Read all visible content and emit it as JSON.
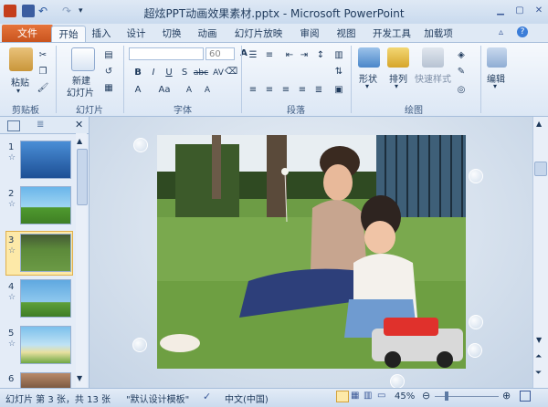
{
  "window": {
    "title": "超炫PPT动画效果素材.pptx - Microsoft PowerPoint",
    "app_icon": "powerpoint-icon",
    "controls": [
      "minimize-icon",
      "maximize-icon",
      "close-icon"
    ]
  },
  "quick_access": [
    "save-icon",
    "undo-icon",
    "redo-icon",
    "customize-icon"
  ],
  "tabs": [
    {
      "label": "文件"
    },
    {
      "label": "开始"
    },
    {
      "label": "插入"
    },
    {
      "label": "设计"
    },
    {
      "label": "切换"
    },
    {
      "label": "动画"
    },
    {
      "label": "幻灯片放映"
    },
    {
      "label": "审阅"
    },
    {
      "label": "视图"
    },
    {
      "label": "开发工具"
    },
    {
      "label": "加载项"
    }
  ],
  "ribbon": {
    "groups": [
      {
        "label": "剪贴板"
      },
      {
        "label": "幻灯片"
      },
      {
        "label": "字体"
      },
      {
        "label": "段落"
      },
      {
        "label": "绘图"
      }
    ],
    "paste_label": "粘贴",
    "new_slide_label_1": "新建",
    "new_slide_label_2": "幻灯片",
    "font_size": "60",
    "shape_label": "形状",
    "arrange_label": "排列",
    "quick_style_label": "快速样式",
    "edit_label": "编辑",
    "font_buttons": [
      "B",
      "I",
      "U",
      "S",
      "abc",
      "AV",
      "Aa",
      "A"
    ]
  },
  "slides_panel": {
    "slides": [
      {
        "num": "1"
      },
      {
        "num": "2"
      },
      {
        "num": "3"
      },
      {
        "num": "4"
      },
      {
        "num": "5"
      },
      {
        "num": "6"
      }
    ],
    "selected": "3"
  },
  "status": {
    "slide_info": "幻灯片 第 3 张，共 13 张",
    "theme": "\"默认设计模板\"",
    "language": "中文(中国)",
    "zoom": "45%"
  },
  "colors": {
    "accent": "#d86c2f",
    "ribbon_bg": "#dce7f5",
    "selection": "#fde9a8"
  }
}
